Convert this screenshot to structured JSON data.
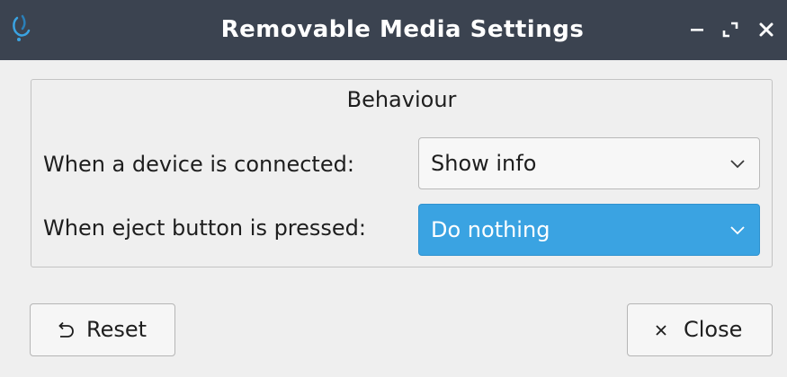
{
  "window": {
    "title": "Removable Media Settings"
  },
  "group": {
    "title": "Behaviour",
    "rows": [
      {
        "label": "When a device is connected:",
        "value": "Show info"
      },
      {
        "label": "When eject button is pressed:",
        "value": "Do nothing"
      }
    ]
  },
  "buttons": {
    "reset_label": "Reset",
    "close_label": "Close"
  },
  "colors": {
    "titlebar": "#3b4350",
    "accent": "#3aa3e2",
    "window_bg": "#efefef"
  },
  "icons": {
    "app": "app-logo-icon",
    "minimize": "minimize-icon",
    "maximize": "maximize-icon",
    "close": "close-icon",
    "dropdown": "chevron-down-icon",
    "reset": "undo-icon",
    "close_button": "x-icon"
  }
}
